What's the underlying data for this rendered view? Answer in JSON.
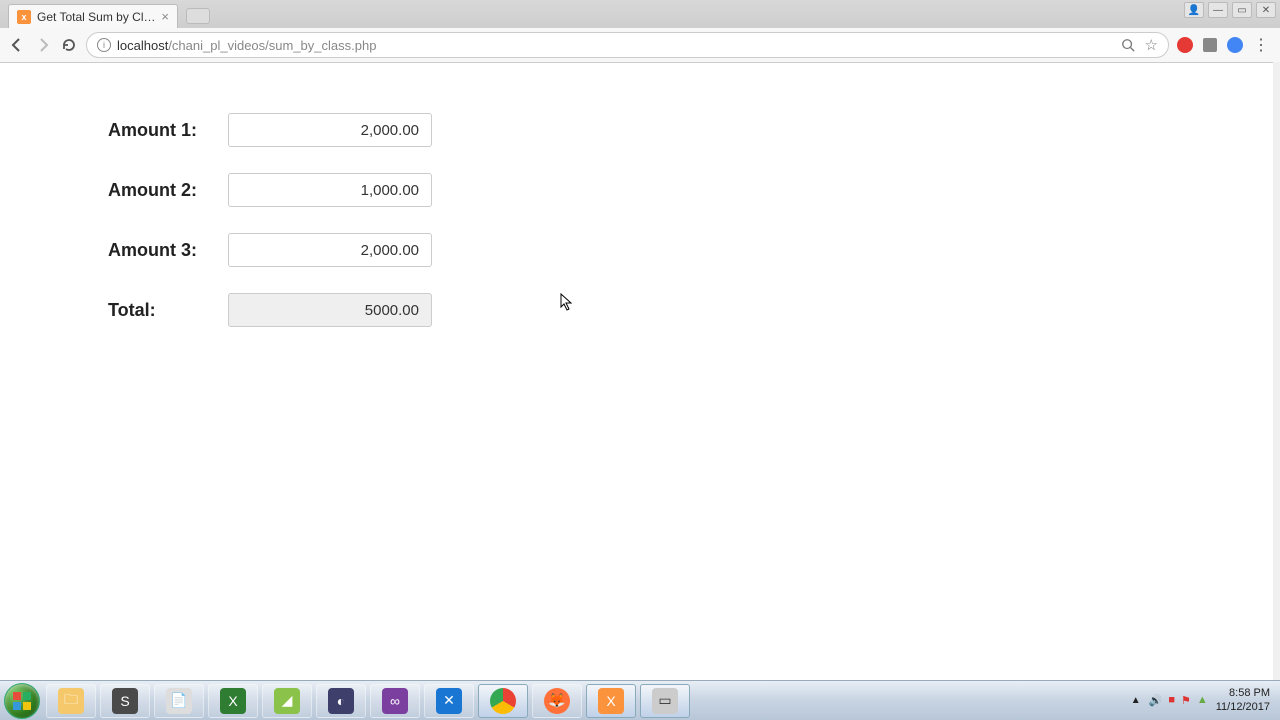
{
  "window": {
    "tab_title": "Get Total Sum by Class N",
    "url_host": "localhost",
    "url_path": "/chani_pl_videos/sum_by_class.php"
  },
  "form": {
    "rows": [
      {
        "label": "Amount 1:",
        "value": "2,000.00"
      },
      {
        "label": "Amount 2:",
        "value": "1,000.00"
      },
      {
        "label": "Amount 3:",
        "value": "2,000.00"
      }
    ],
    "total_label": "Total:",
    "total_value": "5000.00"
  },
  "system": {
    "time": "8:58 PM",
    "date": "11/12/2017"
  }
}
